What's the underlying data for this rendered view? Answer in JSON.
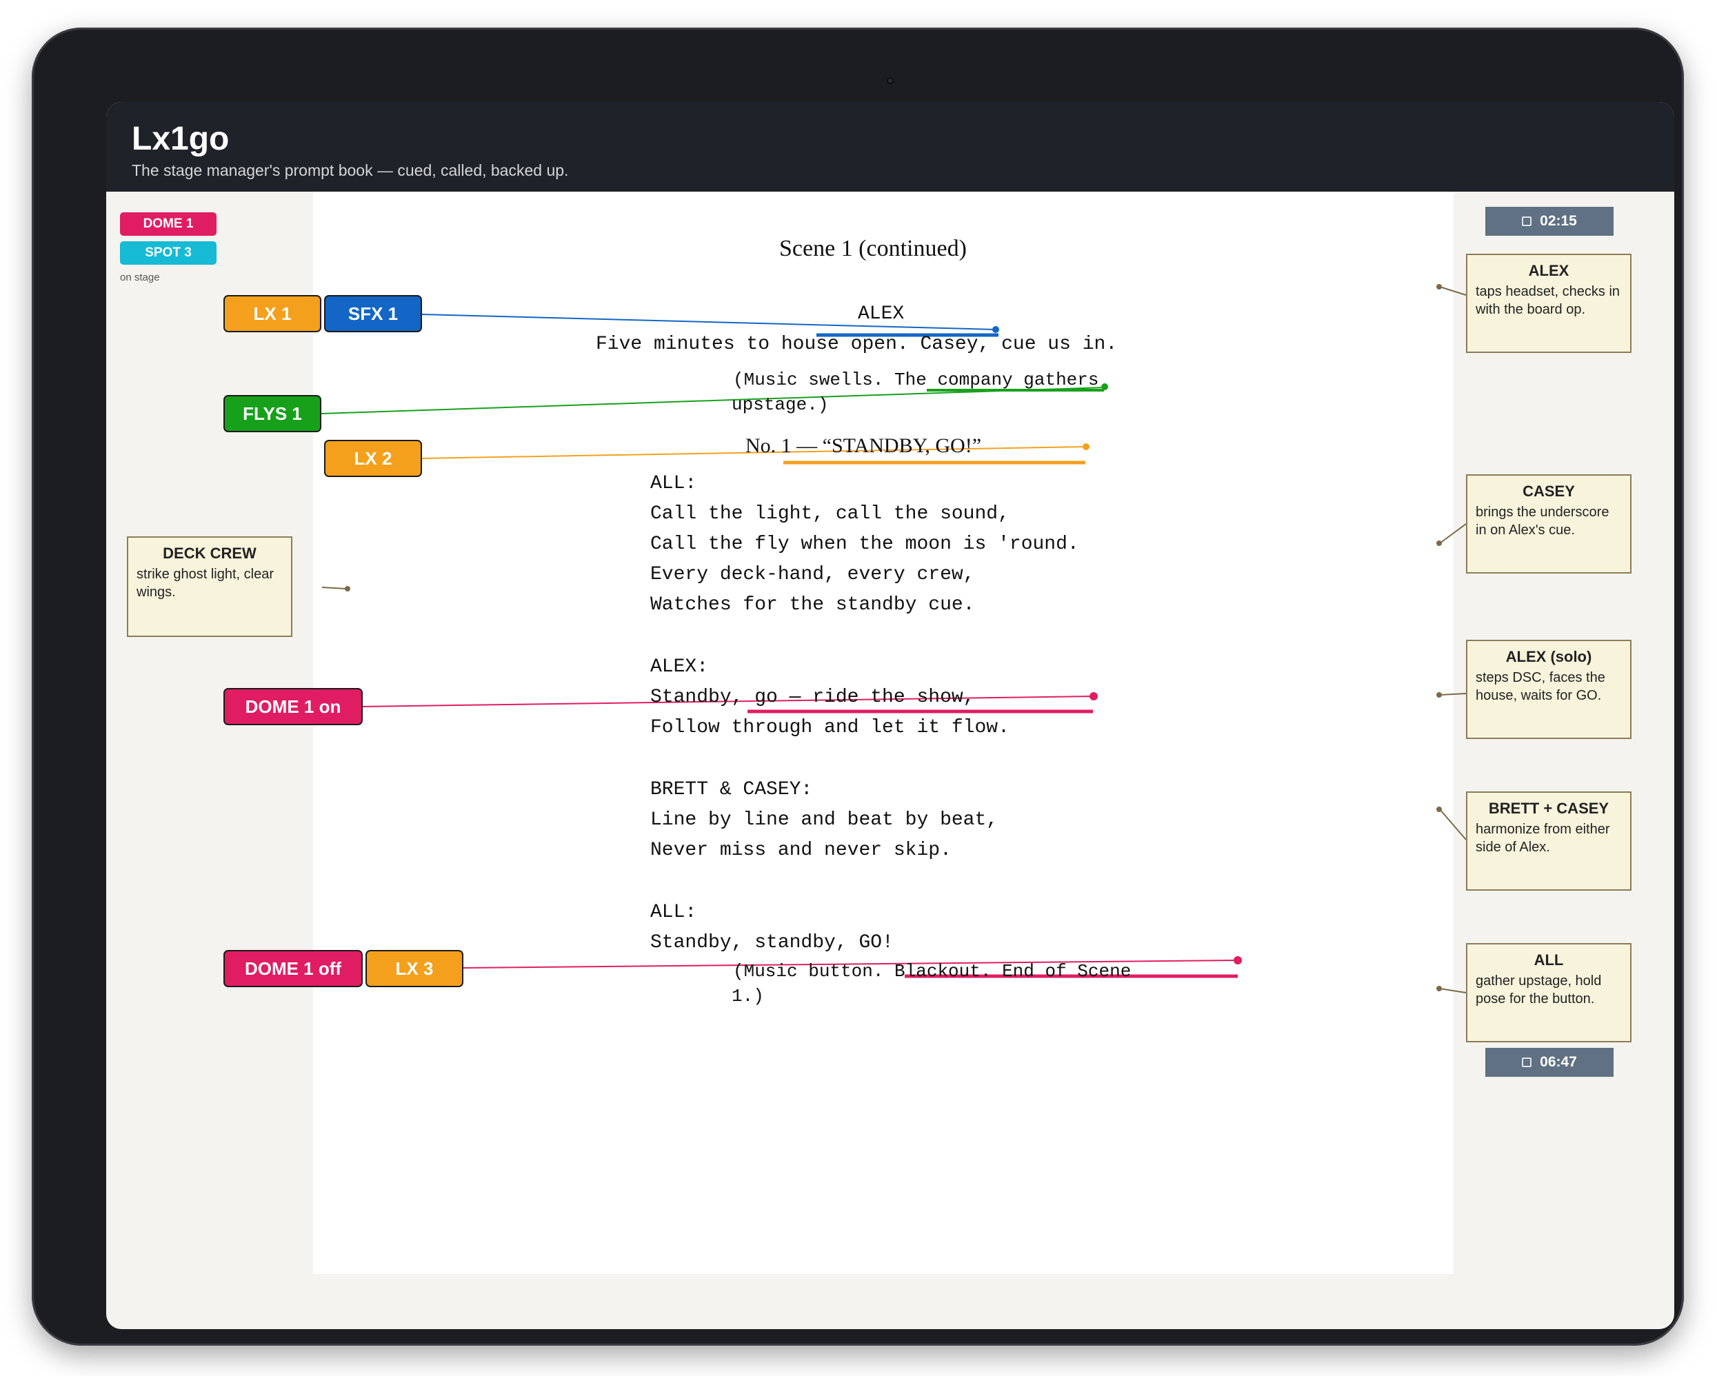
{
  "app": {
    "title": "Lx1go",
    "subtitle": "The stage manager's prompt book — cued, called, backed up."
  },
  "on_stage": {
    "chips": [
      "DOME 1",
      "SPOT 3"
    ],
    "label": "on stage"
  },
  "timers": {
    "top": "02:15",
    "bottom": "06:47"
  },
  "script": {
    "scene_title": "Scene 1 (continued)",
    "character_alex": "ALEX",
    "line_five_minutes": "Five minutes to house open. Casey, cue us in.",
    "stage_dir_1_a": "(Music swells. The company gathers",
    "stage_dir_1_b": "upstage.)",
    "song_title": "No. 1 — “STANDBY, GO!”",
    "lyrics_1_char": "ALL:",
    "lyrics_1": [
      "Call the light, call the sound,",
      "Call the fly when the moon is 'round.",
      "Every deck-hand, every crew,",
      "Watches for the standby cue."
    ],
    "lyrics_2_char": "ALEX:",
    "lyrics_2": [
      "Standby, go — ride the show,",
      "Follow through and let it flow."
    ],
    "lyrics_3_char": "BRETT & CASEY:",
    "lyrics_3": [
      "Line by line and beat by beat,",
      "Never miss and never skip."
    ],
    "lyrics_4_char": "ALL:",
    "lyrics_4": "Standby, standby, GO!",
    "stage_dir_2_a": "(Music button. Blackout. End of Scene",
    "stage_dir_2_b": "1.)"
  },
  "cues": {
    "lx1": "LX 1",
    "sfx1": "SFX 1",
    "flys1": "FLYS 1",
    "lx2": "LX 2",
    "dome1_on": "DOME 1 on",
    "dome1_off": "DOME 1 off",
    "lx3": "LX 3"
  },
  "colors": {
    "lx": "#f4a01c",
    "sfx": "#1366c5",
    "flys": "#17a11b",
    "dome": "#e01d62",
    "spot": "#16bad4"
  },
  "notes": {
    "deck_crew": {
      "title": "DECK CREW",
      "body": "strike ghost light, clear wings."
    },
    "alex": {
      "title": "ALEX",
      "body": "taps headset, checks in with the board op."
    },
    "casey": {
      "title": "CASEY",
      "body": "brings the underscore in on Alex's cue."
    },
    "alex_solo": {
      "title": "ALEX (solo)",
      "body": "steps DSC, faces the house, waits for GO."
    },
    "brett_casey": {
      "title": "BRETT + CASEY",
      "body": "harmonize from either side of Alex."
    },
    "all": {
      "title": "ALL",
      "body": "gather upstage, hold pose for the button."
    }
  }
}
